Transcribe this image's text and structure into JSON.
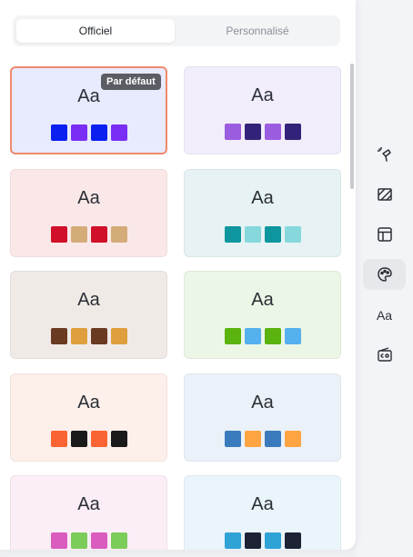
{
  "tabs": [
    {
      "label": "Officiel",
      "active": true
    },
    {
      "label": "Personnalisé",
      "active": false
    }
  ],
  "default_badge": "Par défaut",
  "theme_cards": [
    {
      "sample": "Aa",
      "bg": "#e8eafd",
      "selected": true,
      "colors": [
        "#0a1ff0",
        "#7a2df5",
        "#0a1ff0",
        "#7a2df5"
      ]
    },
    {
      "sample": "Aa",
      "bg": "#f1edfa",
      "selected": false,
      "colors": [
        "#9b5de0",
        "#33227a",
        "#9b5de0",
        "#33227a"
      ]
    },
    {
      "sample": "Aa",
      "bg": "#fae8e8",
      "selected": false,
      "colors": [
        "#d0102a",
        "#d4ac78",
        "#d0102a",
        "#d4ac78"
      ]
    },
    {
      "sample": "Aa",
      "bg": "#e6f2f3",
      "selected": false,
      "colors": [
        "#0e969e",
        "#86d8dc",
        "#0e969e",
        "#86d8dc"
      ]
    },
    {
      "sample": "Aa",
      "bg": "#f0eae7",
      "selected": false,
      "colors": [
        "#6a3a21",
        "#e09f3e",
        "#6a3a21",
        "#e09f3e"
      ]
    },
    {
      "sample": "Aa",
      "bg": "#ecf6e6",
      "selected": false,
      "colors": [
        "#5bb30f",
        "#55b0ee",
        "#5bb30f",
        "#55b0ee"
      ]
    },
    {
      "sample": "Aa",
      "bg": "#fdefea",
      "selected": false,
      "colors": [
        "#fa6433",
        "#1a1a1a",
        "#fa6433",
        "#1a1a1a"
      ]
    },
    {
      "sample": "Aa",
      "bg": "#ebf1f8",
      "selected": false,
      "colors": [
        "#3a7bbd",
        "#ffa442",
        "#3a7bbd",
        "#ffa442"
      ]
    },
    {
      "sample": "Aa",
      "bg": "#fbeef6",
      "selected": false,
      "colors": [
        "#d95cbe",
        "#7ccc5a",
        "#d95cbe",
        "#7ccc5a"
      ]
    },
    {
      "sample": "Aa",
      "bg": "#e9f4fb",
      "selected": false,
      "colors": [
        "#2fa2d6",
        "#1d2334",
        "#2fa2d6",
        "#1d2334"
      ]
    }
  ],
  "toolbar": [
    {
      "icon": "magic-pin-icon",
      "active": false
    },
    {
      "icon": "hatch-pattern-icon",
      "active": false
    },
    {
      "icon": "layout-icon",
      "active": false
    },
    {
      "icon": "palette-icon",
      "active": true
    },
    {
      "icon": "font-icon",
      "label": "Aa",
      "active": false
    },
    {
      "icon": "caption-icon",
      "active": false
    }
  ]
}
